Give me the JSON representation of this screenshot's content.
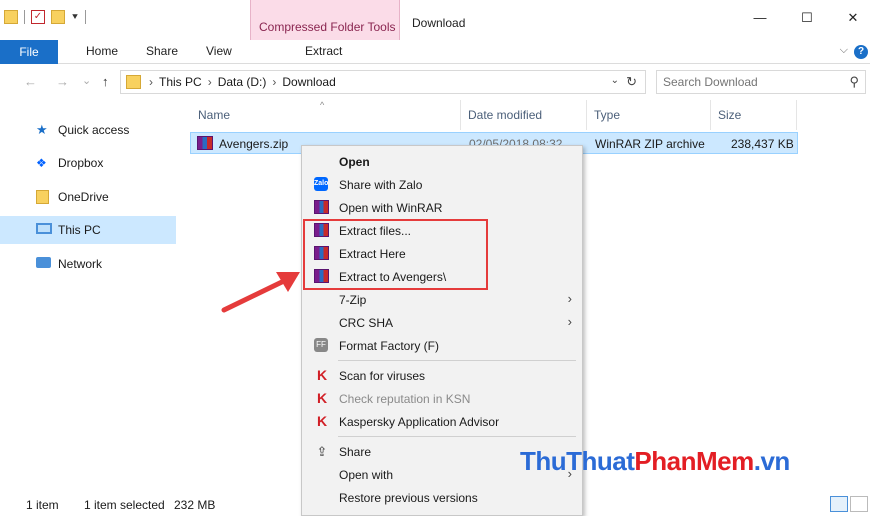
{
  "window": {
    "context_tab": "Compressed Folder Tools",
    "title": "Download",
    "controls": {
      "minimize": "—",
      "maximize": "☐",
      "close": "✕"
    }
  },
  "quick_access_toolbar": {
    "dropdown": "⯆"
  },
  "ribbon": {
    "tabs": [
      "File",
      "Home",
      "Share",
      "View",
      "Extract"
    ],
    "collapse": "⌵",
    "help": "?"
  },
  "navigation": {
    "back": "←",
    "forward": "→",
    "recent": "⌄",
    "up": "↑"
  },
  "address": {
    "crumbs": [
      "This PC",
      "Data (D:)",
      "Download"
    ],
    "separator": "›",
    "dropdown": "⌄",
    "refresh": "↻"
  },
  "search": {
    "placeholder": "Search Download",
    "icon": "⚲"
  },
  "nav_pane": {
    "items": [
      {
        "label": "Quick access",
        "icon": "star-icon",
        "selected": false
      },
      {
        "label": "Dropbox",
        "icon": "dropbox-icon",
        "selected": false
      },
      {
        "label": "OneDrive",
        "icon": "onedrive-icon",
        "selected": false
      },
      {
        "label": "This PC",
        "icon": "pc-icon",
        "selected": true
      },
      {
        "label": "Network",
        "icon": "network-icon",
        "selected": false
      }
    ]
  },
  "file_list": {
    "sort_indicator": "^",
    "columns": [
      "Name",
      "Date modified",
      "Type",
      "Size"
    ],
    "rows": [
      {
        "name": "Avengers.zip",
        "date": "02/05/2018 08:32",
        "type": "WinRAR ZIP archive",
        "size": "238,437 KB"
      }
    ]
  },
  "status": {
    "count": "1 item",
    "selected": "1 item selected",
    "size": "232 MB"
  },
  "context_menu": {
    "items": [
      {
        "label": "Open",
        "icon": "",
        "bold": true
      },
      {
        "label": "Share with Zalo",
        "icon": "zalo"
      },
      {
        "label": "Open with WinRAR",
        "icon": "rar"
      },
      {
        "label": "Extract files...",
        "icon": "rar"
      },
      {
        "label": "Extract Here",
        "icon": "rar"
      },
      {
        "label": "Extract to Avengers\\",
        "icon": "rar"
      },
      {
        "label": "7-Zip",
        "icon": "",
        "submenu": true
      },
      {
        "label": "CRC SHA",
        "icon": "",
        "submenu": true
      },
      {
        "label": "Format Factory (F)",
        "icon": "ff"
      },
      {
        "label": "Scan for viruses",
        "icon": "ksn"
      },
      {
        "label": "Check reputation in KSN",
        "icon": "ksn",
        "disabled": true
      },
      {
        "label": "Kaspersky Application Advisor",
        "icon": "ksn"
      },
      {
        "label": "Share",
        "icon": "share"
      },
      {
        "label": "Open with",
        "icon": "",
        "submenu": true
      },
      {
        "label": "Restore previous versions",
        "icon": ""
      }
    ],
    "icon_glyphs": {
      "zalo": "Zalo",
      "ff": "FF",
      "ksn": "K",
      "share": "⇪"
    },
    "submenu_glyph": "›"
  },
  "watermark": {
    "part1": "ThuThuat",
    "part2": "PhanMem",
    "part3": ".vn"
  },
  "colors": {
    "accent": "#1a6fc8",
    "highlight": "#e53b3b",
    "selection": "#cce8ff"
  }
}
